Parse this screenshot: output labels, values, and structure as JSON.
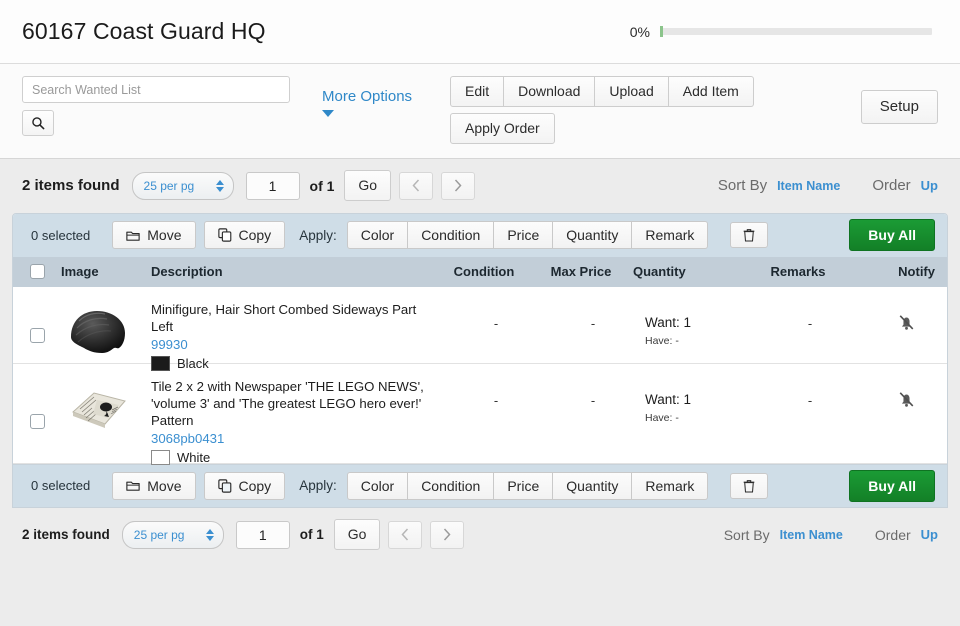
{
  "header": {
    "title": "60167 Coast Guard HQ",
    "progress_pct_label": "0%",
    "progress_value": 0,
    "progress_color": "#8bc48b"
  },
  "toolbar": {
    "search_placeholder": "Search Wanted List",
    "search_value": "",
    "search_icon": "search-icon",
    "more_options_label": "More Options",
    "buttons": [
      {
        "label": "Edit"
      },
      {
        "label": "Download"
      },
      {
        "label": "Upload"
      },
      {
        "label": "Add Item"
      }
    ],
    "apply_order_label": "Apply Order",
    "setup_label": "Setup"
  },
  "pagination": {
    "items_found": "2 items found",
    "per_page": "25 per pg",
    "page_value": "1",
    "of_label": "of 1",
    "go_label": "Go",
    "prev_icon": "chevron-left-icon",
    "next_icon": "chevron-right-icon",
    "sort_by_label": "Sort By",
    "sort_by_value": "Item Name",
    "order_label": "Order",
    "order_value": "Up"
  },
  "actionbar": {
    "selected_count": "0 selected",
    "move_label": "Move",
    "copy_label": "Copy",
    "apply_label": "Apply:",
    "apply_buttons": [
      {
        "label": "Color"
      },
      {
        "label": "Condition"
      },
      {
        "label": "Price"
      },
      {
        "label": "Quantity"
      },
      {
        "label": "Remark"
      }
    ],
    "delete_icon": "trash-icon",
    "buy_all_label": "Buy All",
    "buy_all_color": "#16882b"
  },
  "table": {
    "columns": [
      {
        "key": "image",
        "label": "Image"
      },
      {
        "key": "description",
        "label": "Description"
      },
      {
        "key": "condition",
        "label": "Condition"
      },
      {
        "key": "max_price",
        "label": "Max Price"
      },
      {
        "key": "quantity",
        "label": "Quantity"
      },
      {
        "key": "remarks",
        "label": "Remarks"
      },
      {
        "key": "notify",
        "label": "Notify"
      }
    ],
    "rows": [
      {
        "description": "Minifigure, Hair Short Combed Sideways Part Left",
        "item_no": "99930",
        "color_name": "Black",
        "color_hex": "#1b1b1b",
        "condition": "-",
        "max_price": "-",
        "want": "Want: 1",
        "have": "Have: -",
        "remarks": "-",
        "notify_icon": "bell-off-icon"
      },
      {
        "description": "Tile 2 x 2 with Newspaper 'THE LEGO NEWS', 'volume 3' and 'The greatest LEGO hero ever!' Pattern",
        "item_no": "3068pb0431",
        "color_name": "White",
        "color_hex": "#ffffff",
        "condition": "-",
        "max_price": "-",
        "want": "Want: 1",
        "have": "Have: -",
        "remarks": "-",
        "notify_icon": "bell-off-icon"
      }
    ]
  },
  "pagination_bottom": {
    "items_found": "2 items found",
    "per_page": "25 per pg",
    "page_value": "1",
    "of_label": "of 1",
    "go_label": "Go",
    "sort_by_label": "Sort By",
    "sort_by_value": "Item Name",
    "order_label": "Order",
    "order_value": "Up"
  }
}
